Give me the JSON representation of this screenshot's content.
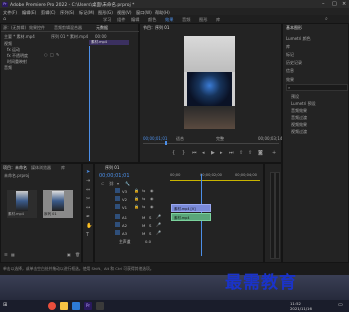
{
  "app": {
    "title": "Adobe Premiere Pro 2022 - C:\\Users\\桌面\\未命名.prproj *",
    "logo": "Pr"
  },
  "menus": [
    "文件(F)",
    "编辑(E)",
    "剪辑(C)",
    "序列(S)",
    "标记(M)",
    "图形(G)",
    "视图(V)",
    "窗口(W)",
    "帮助(H)"
  ],
  "workspaces": [
    "学习",
    "组件",
    "编辑",
    "颜色",
    "效果",
    "音频",
    "图形",
    "库"
  ],
  "active_workspace": "效果",
  "source_panel": {
    "tabs": [
      "源：(无剪辑)",
      "效果控件",
      "音频剪辑混合器",
      "元数据"
    ],
    "active_tab": "效果控件",
    "clip_label": "主要 * 素材.mp4",
    "sequence_label": "序列 01 * 素材.mp4",
    "time_marker": "00:00",
    "clip_bar_label": "素材.mp4",
    "section_video": "视频",
    "rows": [
      "fx 运动",
      "fx 不透明度",
      "时间重映射"
    ],
    "audio_label": "音频"
  },
  "program_monitor": {
    "tab": "节目：序列 01",
    "timecode_current": "00;00;01;01",
    "fit_label": "适合",
    "quality_label": "完整",
    "timecode_total": "00;00;03;14"
  },
  "right_panel": {
    "tab": "基本图形",
    "items": [
      "Lumetri 颜色",
      "库",
      "标记",
      "历史记录",
      "信息"
    ],
    "effects_tab": "效果",
    "effects_list": [
      "预设",
      "Lumetri 预设",
      "音频效果",
      "音频过渡",
      "视频效果",
      "视频过渡"
    ]
  },
  "project_panel": {
    "tabs": [
      "项目：未命名",
      "媒体浏览器",
      "库"
    ],
    "path": "未命名.prproj",
    "items": [
      {
        "name": "素材.mp4",
        "duration": "3:14"
      },
      {
        "name": "序列 01",
        "duration": "3:14"
      }
    ]
  },
  "timeline": {
    "tab": "序列 01",
    "timecode": "00;00;01;01",
    "ruler": [
      "00;00",
      "00;00;02;00",
      "00;00;04;00"
    ],
    "video_tracks": [
      "V3",
      "V2",
      "V1"
    ],
    "audio_tracks": [
      "A1",
      "A2",
      "A3"
    ],
    "master_label": "主声道",
    "master_value": "0.0",
    "video_clip": "素材.mp4 [V]",
    "audio_clip": "素材.mp4",
    "footer_note": "单击以选择，或单击空白处并拖动以进行框选。使用 Shift、Alt 和 Ctrl 可获得其他选项。"
  },
  "watermark": "最需教育",
  "taskbar": {
    "time": "11:52",
    "date": "2021/11/16"
  }
}
